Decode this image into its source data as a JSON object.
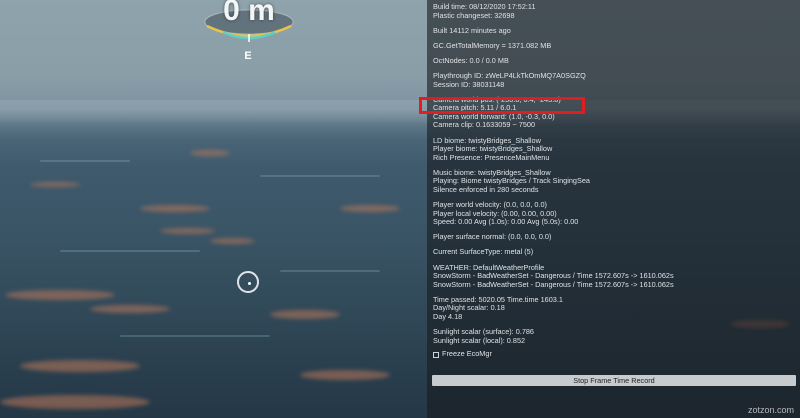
{
  "hud": {
    "depth_label": "0 m",
    "compass_heading": "E"
  },
  "debug": {
    "lines": [
      "Build time: 08/12/2020 17:52:11",
      "Plastic changeset: 32698",
      "",
      "Built 14112 minutes ago",
      "",
      "GC.GetTotalMemory = 1371.082 MB",
      "",
      "OctNodes: 0.0 / 0.0 MB",
      "",
      "Playthrough ID: zWeLP4LkTkOmMQ7A0SGZQ",
      "Session ID: 38031148",
      "",
      "Camera world pos: (-250.8, 0.4, -245.8)",
      "Camera pitch: 5.11 / 6.0.1",
      "Camera world forward: (1.0, -0.3, 0.0)",
      "Camera clip: 0.1633059 ~ 7500",
      "",
      "LD biome: twistyBridges_Shallow",
      "Player biome: twistyBridges_Shallow",
      "Rich Presence: PresenceMainMenu",
      "",
      "Music biome: twistyBridges_Shallow",
      "Playing: Biome twistyBridges / Track SingingSea",
      "Silence enforced in 280 seconds",
      "",
      "Player world velocity: (0.0, 0.0, 0.0)",
      "Player local velocity: (0.00, 0.00, 0.00)",
      "Speed: 0.00 Avg (1.0s): 0.00 Avg (5.0s): 0.00",
      "",
      "Player surface normal: (0.0, 0.0, 0.0)",
      "",
      "Current SurfaceType: metal (5)",
      "",
      "WEATHER: DefaultWeatherProfile",
      "SnowStorm - BadWeatherSet - Dangerous / Time 1572.607s -> 1610.062s",
      "SnowStorm - BadWeatherSet - Dangerous / Time 1572.607s -> 1610.062s",
      "",
      "Time passed: 5020.05  Time.time 1603.1",
      "Day/Night scalar: 0.18",
      "Day 4.18",
      "",
      "Sunlight scalar (surface): 0.786",
      "Sunlight scalar (local): 0.852"
    ],
    "freeze_label": "Freeze EcoMgr",
    "record_button_label": "Stop Frame Time Record"
  },
  "watermark": "zotzon.com",
  "colors": {
    "highlight": "#e11d22",
    "panel_bg": "rgba(25,28,32,0.62)"
  }
}
